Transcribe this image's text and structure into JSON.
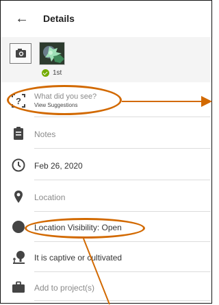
{
  "header": {
    "back_icon": "arrow-left-icon",
    "title": "Details"
  },
  "photos": {
    "camera_icon": "camera-icon",
    "count_label": "1st",
    "check_color": "#74ac00"
  },
  "observation": {
    "species_placeholder": "What did you see?",
    "suggestions_link": "View Suggestions",
    "notes_placeholder": "Notes",
    "date": "Feb 26, 2020",
    "location_placeholder": "Location",
    "location_visibility": "Location Visibility: Open",
    "captive_label": "It is captive or cultivated",
    "projects_label": "Add to project(s)"
  },
  "annotation_color": "#d26900"
}
